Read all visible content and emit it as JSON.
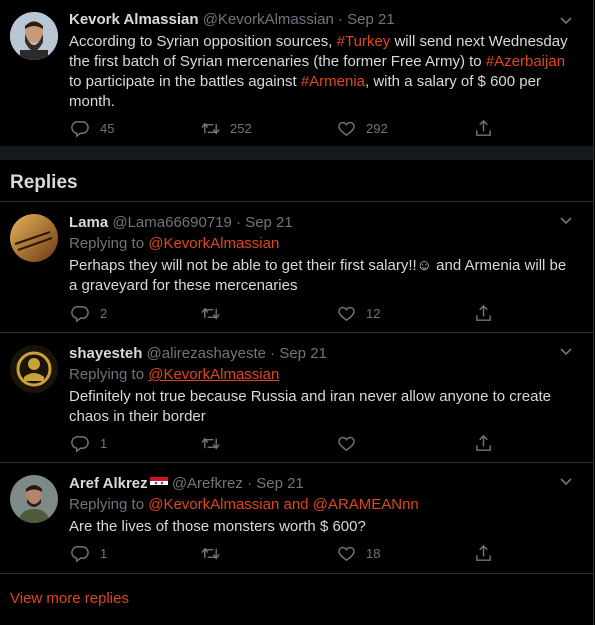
{
  "colors": {
    "accent": "#e0461b",
    "muted": "#6e767d",
    "text": "#d9d9d9",
    "background": "#000000"
  },
  "main_tweet": {
    "display_name": "Kevork Almassian",
    "handle": "@KevorkAlmassian",
    "date": "· Sep 21",
    "text_1": "According to Syrian opposition sources, ",
    "tag_1": "#Turkey",
    "text_2": " will send next Wednesday the first batch of Syrian mercenaries (the former Free Army) to ",
    "tag_2": "#Azerbaijan",
    "text_3": " to participate in the battles against ",
    "tag_3": "#Armenia",
    "text_4": ", with a salary of $ 600 per month.",
    "reply_count": "45",
    "retweet_count": "252",
    "like_count": "292"
  },
  "replies_heading": "Replies",
  "replies": [
    {
      "display_name": "Lama",
      "handle": "@Lama66690719",
      "date": "· Sep 21",
      "replying_label": "Replying to ",
      "replying_to": "@KevorkAlmassian",
      "text": "Perhaps they will not be able to get their first salary!!☺ and Armenia will be a graveyard for these mercenaries",
      "reply_count": "2",
      "retweet_count": "",
      "like_count": "12"
    },
    {
      "display_name": "shayesteh",
      "handle": "@alirezashayeste",
      "date": "· Sep 21",
      "replying_label": "Replying to ",
      "replying_to": "@KevorkAlmassian",
      "text": "Definitely not true because Russia and iran never allow anyone to create chaos in their border",
      "reply_count": "1",
      "retweet_count": "",
      "like_count": ""
    },
    {
      "display_name": "Aref Alkrez",
      "handle": "@Arefkrez",
      "date": "· Sep 21",
      "replying_label": "Replying to ",
      "replying_to": "@KevorkAlmassian and @ARAMEANnn",
      "text": "Are the lives of those monsters worth $ 600?",
      "reply_count": "1",
      "retweet_count": "",
      "like_count": "18"
    }
  ],
  "view_more": "View more replies",
  "icons": [
    "chevron-down-icon",
    "reply-icon",
    "retweet-icon",
    "like-icon",
    "share-icon",
    "syria-flag-icon"
  ]
}
